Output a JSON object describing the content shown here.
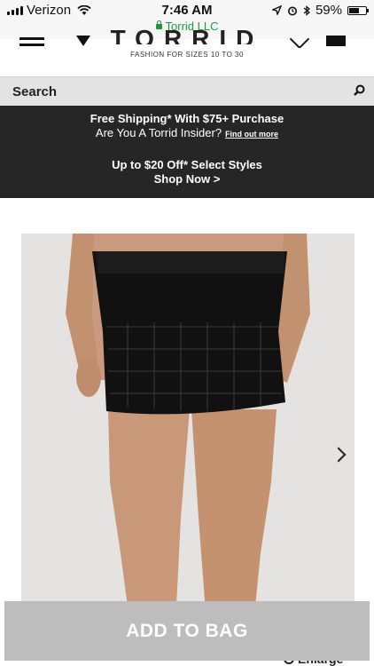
{
  "status_bar": {
    "carrier": "Verizon",
    "time": "7:46 AM",
    "site": "Torrid LLC",
    "battery": "59%",
    "battery_level": 0.59
  },
  "header": {
    "logo": "TORRID",
    "tagline": "FASHION FOR SIZES 10 TO 30",
    "icons": [
      "menu-icon",
      "heart-icon",
      "bag-icon"
    ]
  },
  "search": {
    "label": "Search",
    "icon": "search-icon"
  },
  "promo": {
    "line1": "Free Shipping* With $75+ Purchase",
    "line2": "Are You A Torrid Insider?",
    "link": "Find out more",
    "line3": "Up to $20 Off* Select Styles",
    "line4": "Shop Now >"
  },
  "product": {
    "next_icon": "chevron-right-icon"
  },
  "cta": {
    "add_to_bag": "ADD TO BAG",
    "enlarge": "Enlarge"
  },
  "colors": {
    "promo_bg": "#262626",
    "search_bg": "#e3e3e3",
    "cta_bg": "#bdbdbd",
    "site_green": "#1a9b3b"
  }
}
